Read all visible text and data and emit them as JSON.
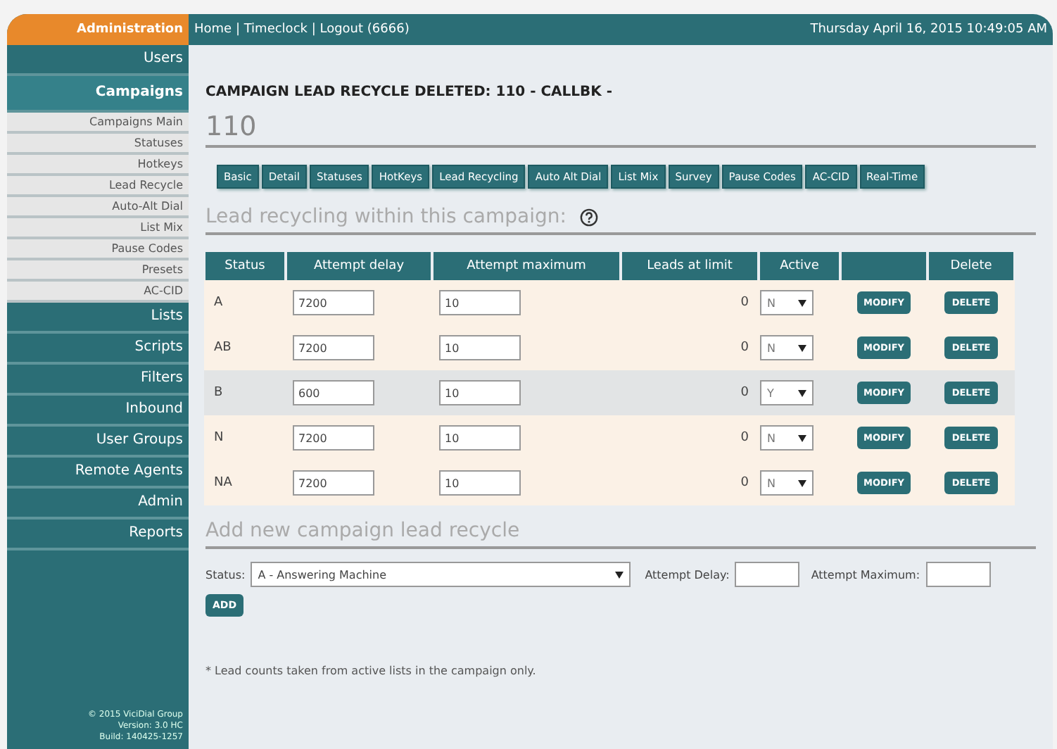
{
  "header": {
    "brand": "Administration",
    "nav": "Home | Timeclock | Logout (6666)",
    "datetime": "Thursday April 16, 2015 10:49:05 AM"
  },
  "sidebar": {
    "items": [
      {
        "label": "Users",
        "kind": "section",
        "selected": false
      },
      {
        "label": "Campaigns",
        "kind": "section",
        "selected": true
      },
      {
        "label": "Campaigns Main",
        "kind": "sub",
        "selected": false
      },
      {
        "label": "Statuses",
        "kind": "sub",
        "selected": false
      },
      {
        "label": "Hotkeys",
        "kind": "sub",
        "selected": false
      },
      {
        "label": "Lead Recycle",
        "kind": "sub",
        "selected": false
      },
      {
        "label": "Auto-Alt Dial",
        "kind": "sub",
        "selected": false
      },
      {
        "label": "List Mix",
        "kind": "sub",
        "selected": false
      },
      {
        "label": "Pause Codes",
        "kind": "sub",
        "selected": false
      },
      {
        "label": "Presets",
        "kind": "sub",
        "selected": false
      },
      {
        "label": "AC-CID",
        "kind": "sub",
        "selected": false
      },
      {
        "label": "Lists",
        "kind": "section",
        "selected": false
      },
      {
        "label": "Scripts",
        "kind": "section",
        "selected": false
      },
      {
        "label": "Filters",
        "kind": "section",
        "selected": false
      },
      {
        "label": "Inbound",
        "kind": "section",
        "selected": false
      },
      {
        "label": "User Groups",
        "kind": "section",
        "selected": false
      },
      {
        "label": "Remote Agents",
        "kind": "section",
        "selected": false
      },
      {
        "label": "Admin",
        "kind": "section",
        "selected": false
      },
      {
        "label": "Reports",
        "kind": "section",
        "selected": false
      }
    ],
    "footer": [
      "© 2015 ViciDial Group",
      "Version: 3.0 HC",
      "Build: 140425-1257"
    ]
  },
  "message": "CAMPAIGN LEAD RECYCLE DELETED: 110 - CALLBK -",
  "campaign_id": "110",
  "tabs": [
    "Basic",
    "Detail",
    "Statuses",
    "HotKeys",
    "Lead Recycling",
    "Auto Alt Dial",
    "List Mix",
    "Survey",
    "Pause Codes",
    "AC-CID",
    "Real-Time"
  ],
  "section_title": "Lead recycling within this campaign:",
  "table": {
    "columns": [
      "Status",
      "Attempt delay",
      "Attempt maximum",
      "Leads at limit",
      "Active",
      "",
      "Delete"
    ],
    "rows": [
      {
        "status": "A",
        "delay": "7200",
        "maximum": "10",
        "leads": "0",
        "active": "N",
        "highlighted": false,
        "modify": "MODIFY",
        "delete": "DELETE"
      },
      {
        "status": "AB",
        "delay": "7200",
        "maximum": "10",
        "leads": "0",
        "active": "N",
        "highlighted": false,
        "modify": "MODIFY",
        "delete": "DELETE"
      },
      {
        "status": "B",
        "delay": "600",
        "maximum": "10",
        "leads": "0",
        "active": "Y",
        "highlighted": true,
        "modify": "MODIFY",
        "delete": "DELETE"
      },
      {
        "status": "N",
        "delay": "7200",
        "maximum": "10",
        "leads": "0",
        "active": "N",
        "highlighted": false,
        "modify": "MODIFY",
        "delete": "DELETE"
      },
      {
        "status": "NA",
        "delay": "7200",
        "maximum": "10",
        "leads": "0",
        "active": "N",
        "highlighted": false,
        "modify": "MODIFY",
        "delete": "DELETE"
      }
    ]
  },
  "add_form": {
    "title": "Add new campaign lead recycle",
    "status_label": "Status:",
    "status_value": "A - Answering Machine",
    "delay_label": "Attempt Delay:",
    "maximum_label": "Attempt Maximum:",
    "button": "ADD"
  },
  "note": "* Lead counts taken from active lists in the campaign only."
}
